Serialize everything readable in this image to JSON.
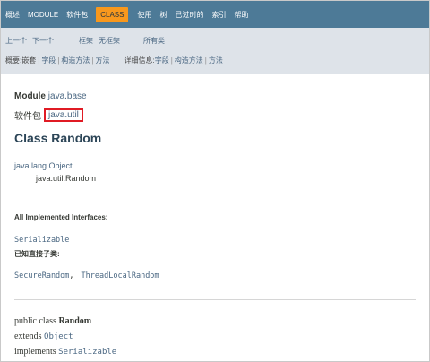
{
  "topnav": {
    "items": [
      "概述",
      "MODULE",
      "软件包",
      "CLASS",
      "使用",
      "树",
      "已过时的",
      "索引",
      "帮助"
    ],
    "active_index": 3
  },
  "subnav": {
    "prev": "上一个",
    "next": "下一个",
    "frames": "框架",
    "no_frames": "无框架",
    "all_classes": "所有类",
    "summary_label": "概要:",
    "summary_items": [
      "嵌套",
      "字段",
      "构造方法",
      "方法"
    ],
    "detail_label": "详细信息:",
    "detail_items": [
      "字段",
      "构造方法",
      "方法"
    ]
  },
  "main": {
    "module_keyword": "Module",
    "module_name": "java.base",
    "package_label": "软件包",
    "package_name": "java.util",
    "class_title": "Class Random",
    "inheritance_parent": "java.lang.Object",
    "inheritance_child": "java.util.Random",
    "interfaces_title": "All Implemented Interfaces:",
    "interfaces": [
      "Serializable"
    ],
    "subclasses_title": "已知直接子类:",
    "subclasses": [
      "SecureRandom",
      "ThreadLocalRandom"
    ],
    "subclass_separator": ",",
    "signature": {
      "line1_prefix": "public class ",
      "line1_name": "Random",
      "line2_prefix": "extends ",
      "line2_link": "Object",
      "line3_prefix": "implements ",
      "line3_link": "Serializable"
    }
  },
  "colors": {
    "topnav_bg": "#4d7a97",
    "active_tab_bg": "#f8981d",
    "subnav_bg": "#dee3e9",
    "link": "#4a6782",
    "highlight_border": "#e01b24"
  }
}
